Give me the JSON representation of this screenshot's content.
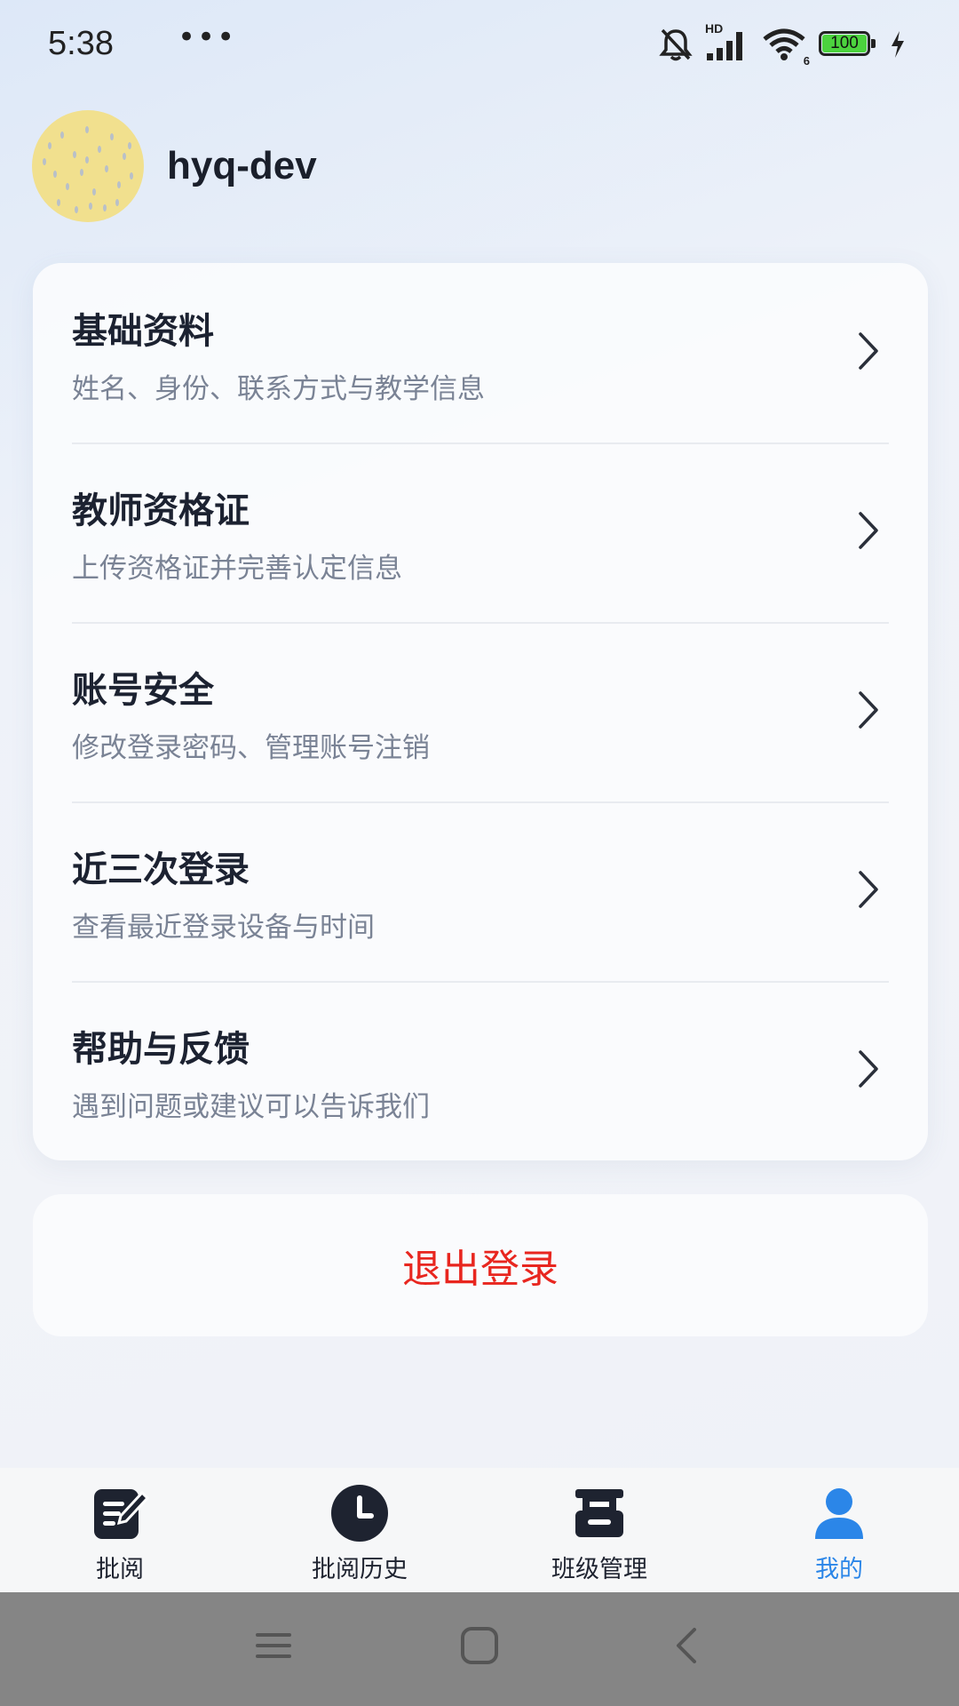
{
  "status_bar": {
    "time": "5:38",
    "more": "•••",
    "battery": "100",
    "signal_label": "HD",
    "wifi_label": "6",
    "icons": [
      "bell-mute-icon",
      "signal-icon",
      "wifi-icon",
      "battery-icon",
      "charging-icon"
    ]
  },
  "profile": {
    "username": "hyq-dev"
  },
  "menu": {
    "items": [
      {
        "title": "基础资料",
        "subtitle": "姓名、身份、联系方式与教学信息"
      },
      {
        "title": "教师资格证",
        "subtitle": "上传资格证并完善认定信息"
      },
      {
        "title": "账号安全",
        "subtitle": "修改登录密码、管理账号注销"
      },
      {
        "title": "近三次登录",
        "subtitle": "查看最近登录设备与时间"
      },
      {
        "title": "帮助与反馈",
        "subtitle": "遇到问题或建议可以告诉我们"
      }
    ]
  },
  "logout": {
    "label": "退出登录"
  },
  "tabs": [
    {
      "label": "批阅",
      "icon": "edit-icon"
    },
    {
      "label": "批阅历史",
      "icon": "clock-icon"
    },
    {
      "label": "班级管理",
      "icon": "class-icon"
    },
    {
      "label": "我的",
      "icon": "user-icon",
      "active": true
    }
  ],
  "colors": {
    "accent": "#2b86e8",
    "danger": "#e8261f"
  }
}
